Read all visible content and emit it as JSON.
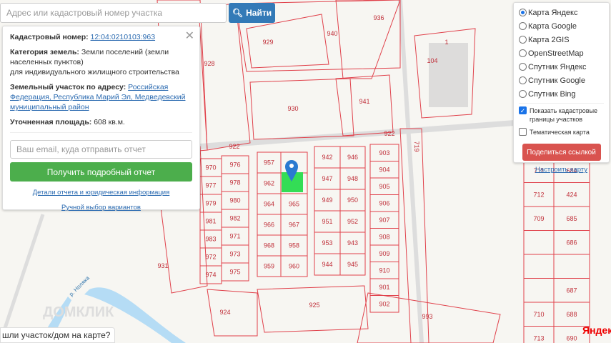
{
  "search": {
    "placeholder": "Адрес или кадастровый номер участка",
    "button": "Найти"
  },
  "info": {
    "cad_label": "Кадастровый номер:",
    "cad_value": "12:04:0210103:963",
    "cat_label": "Категория земель:",
    "cat_value": "Земли поселений (земли населенных пунктов)",
    "cat_use": "для индивидуального жилищного строительства",
    "addr_label": "Земельный участок по адресу:",
    "addr_value": "Российская Федерация, Республика Марий Эл, Медведевский муниципальный район",
    "area_label": "Уточненная площадь:",
    "area_value": "608 кв.м.",
    "email_placeholder": "Ваш email, куда отправить отчет",
    "report_button": "Получить подробный отчет",
    "details_link": "Детали отчета и юридическая информация",
    "manual_link": "Ручной выбор вариантов"
  },
  "layers": {
    "options": [
      "Карта Яндекс",
      "Карта Google",
      "Карта 2GIS",
      "OpenStreetMap",
      "Спутник Яндекс",
      "Спутник Google",
      "Спутник Bing"
    ],
    "selected": 0,
    "show_borders": "Показать кадастровые границы участков",
    "thematic": "Тематическая карта",
    "share": "Поделиться ссылкой",
    "setup": "Настроить карту"
  },
  "bottom": {
    "found": "шли участок/дом на карте?",
    "yandex": "Яндекс",
    "watermark": "ДОМКЛИК",
    "river": "р. Ноляка"
  },
  "map": {
    "colA": [
      "970",
      "977",
      "979",
      "981",
      "983",
      "972",
      "974"
    ],
    "colB": [
      "976",
      "978",
      "980",
      "982",
      "971",
      "973",
      "975"
    ],
    "colC": [
      "957",
      "962",
      "964",
      "966",
      "968",
      "959"
    ],
    "colD": [
      "",
      "",
      "965",
      "967",
      "958",
      "960"
    ],
    "colE": [
      "942",
      "947",
      "949",
      "951",
      "953",
      "944"
    ],
    "colF": [
      "946",
      "948",
      "950",
      "952",
      "943",
      "945"
    ],
    "colG": [
      "903",
      "904",
      "905",
      "906",
      "907",
      "908",
      "909",
      "910",
      "901",
      "902"
    ],
    "colR1": [
      "711",
      "712",
      "709",
      "",
      "",
      "",
      "710",
      "713"
    ],
    "colR2": [
      "684",
      "424",
      "685",
      "686",
      "",
      "687",
      "688",
      "690"
    ],
    "big": [
      "929",
      "940",
      "930",
      "941",
      "936",
      "104",
      "928",
      "922",
      "931",
      "924",
      "925",
      "993",
      "719",
      "922",
      "1"
    ]
  },
  "colors": {
    "parcel": "#e0404a",
    "selected": "#33dd55",
    "pin": "#2a7ad0"
  }
}
